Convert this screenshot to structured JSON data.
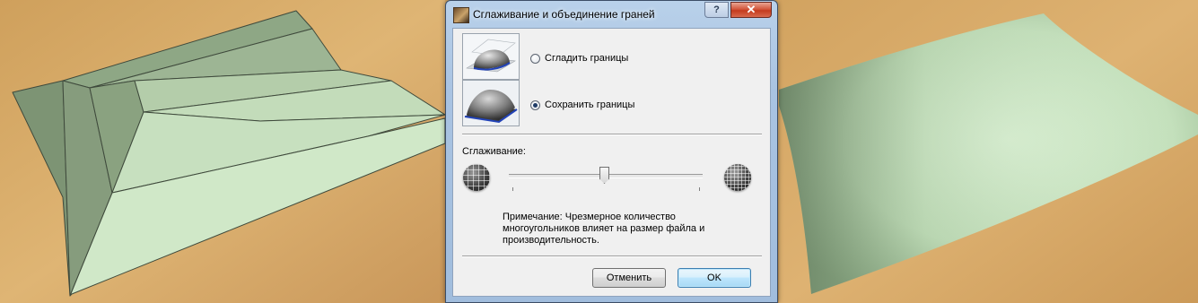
{
  "dialog": {
    "title": "Сглаживание и объединение граней",
    "help_label": "?",
    "close_label": "✕",
    "options": [
      {
        "label": "Сгладить границы",
        "selected": false
      },
      {
        "label": "Сохранить границы",
        "selected": true
      }
    ],
    "smoothing_label": "Сглаживание:",
    "smoothing_level_percent": 50,
    "note": "Примечание: Чрезмерное количество многоугольников влияет на размер файла и производительность.",
    "cancel_label": "Отменить",
    "ok_label": "OK"
  },
  "colors": {
    "surface_flat": "#a9c49e",
    "surface_smooth": "#c4e2bf",
    "floor_wood": "#d6a865",
    "selection_edge": "#2243b8"
  },
  "icons": [
    "app-icon",
    "help-icon",
    "close-icon",
    "faceted-sphere-icon",
    "smooth-sphere-icon"
  ]
}
